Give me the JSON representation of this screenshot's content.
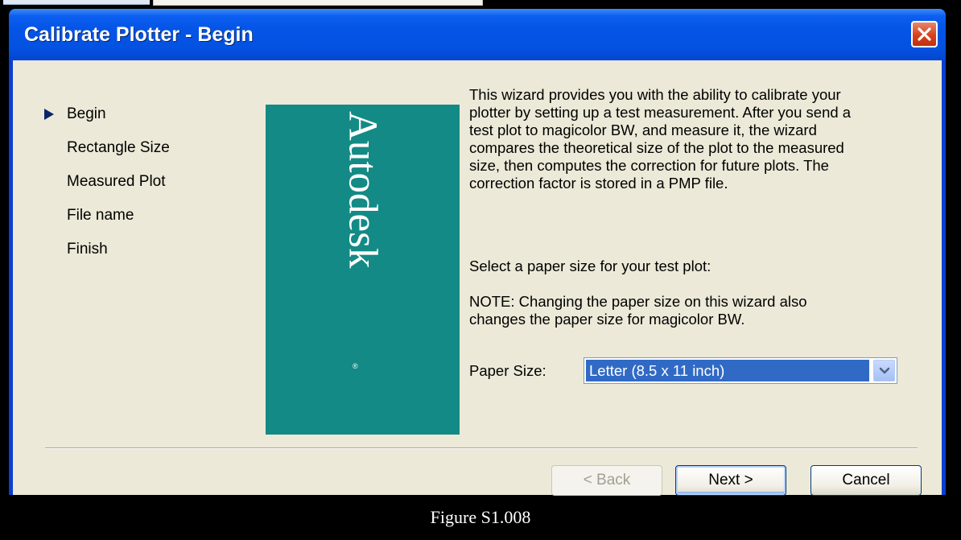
{
  "window": {
    "title": "Calibrate Plotter - Begin"
  },
  "steps": [
    {
      "label": "Begin",
      "current": true
    },
    {
      "label": "Rectangle Size",
      "current": false
    },
    {
      "label": "Measured Plot",
      "current": false
    },
    {
      "label": "File name",
      "current": false
    },
    {
      "label": "Finish",
      "current": false
    }
  ],
  "brand": {
    "name": "Autodesk",
    "reg_mark": "®",
    "color": "#138a85"
  },
  "description": [
    "This wizard provides you with the ability to calibrate your",
    "plotter by setting up a test measurement. After you send a",
    "test plot to magicolor BW, and measure it, the wizard",
    "compares the theoretical size of the plot to the measured",
    "size, then computes the correction for future plots. The",
    "correction factor is stored in a PMP file."
  ],
  "select_prompt": "Select a paper size for your test plot:",
  "note": [
    "NOTE: Changing the paper size on this wizard also",
    "changes the paper size for magicolor BW."
  ],
  "paper_size": {
    "label": "Paper Size:",
    "value": "Letter (8.5 x 11 inch)"
  },
  "buttons": {
    "back": "< Back",
    "next": "Next >",
    "cancel": "Cancel"
  },
  "caption": "Figure S1.008",
  "colors": {
    "titlebar": "#0454e6",
    "client": "#ece9d8",
    "selection": "#316ac5",
    "close": "#d8401c"
  },
  "icons": {
    "close": "close-x-icon",
    "step_marker": "triangle-right-icon",
    "dropdown": "chevron-down-icon"
  }
}
